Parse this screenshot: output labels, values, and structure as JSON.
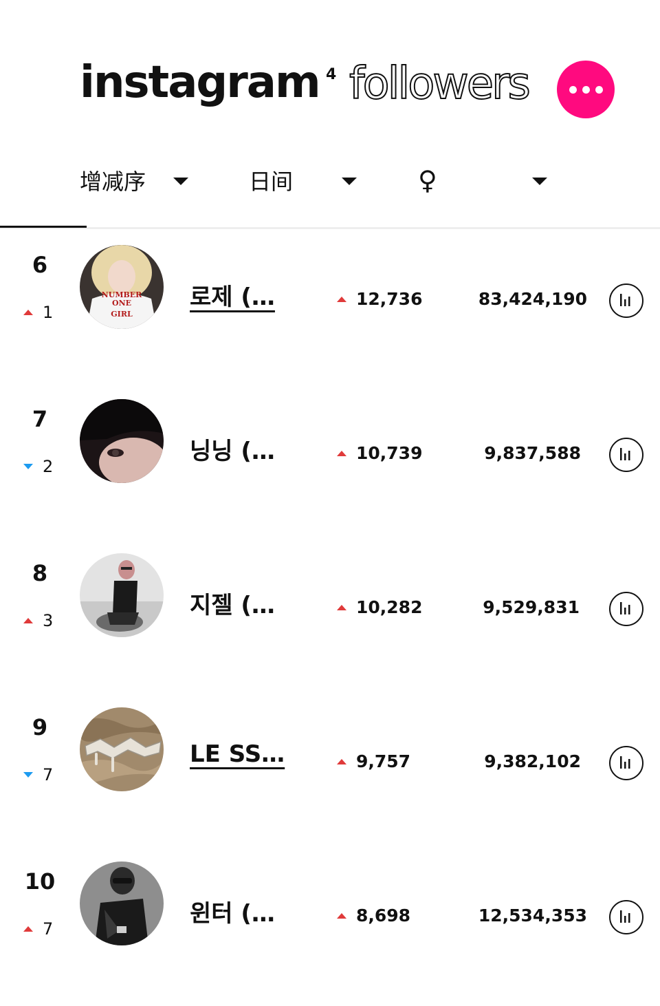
{
  "header": {
    "brand": "instagram",
    "brand_superscript": "4",
    "section_title": "followers",
    "more_icon": "more-dots-icon",
    "accent_color": "#ff0a7f"
  },
  "filters": [
    {
      "label": "增减序"
    },
    {
      "label": "日间"
    },
    {
      "label": "♀"
    }
  ],
  "rows": [
    {
      "rank": "6",
      "change_dir": "up",
      "change": "1",
      "name": "로제 (…",
      "linked": true,
      "gain": "12,736",
      "total": "83,424,190"
    },
    {
      "rank": "7",
      "change_dir": "down",
      "change": "2",
      "name": "닝닝 (…",
      "linked": false,
      "gain": "10,739",
      "total": "9,837,588"
    },
    {
      "rank": "8",
      "change_dir": "up",
      "change": "3",
      "name": "지젤 (…",
      "linked": false,
      "gain": "10,282",
      "total": "9,529,831"
    },
    {
      "rank": "9",
      "change_dir": "down",
      "change": "7",
      "name": "LE SS…",
      "linked": true,
      "gain": "9,757",
      "total": "9,382,102"
    },
    {
      "rank": "10",
      "change_dir": "up",
      "change": "7",
      "name": "윈터 (…",
      "linked": false,
      "gain": "8,698",
      "total": "12,534,353"
    }
  ],
  "avatar_texts": {
    "rose_shirt": [
      "NUMBER",
      "ONE",
      "GIRL"
    ]
  },
  "colors": {
    "up": "#e03a3a",
    "down": "#1d9bf0"
  }
}
